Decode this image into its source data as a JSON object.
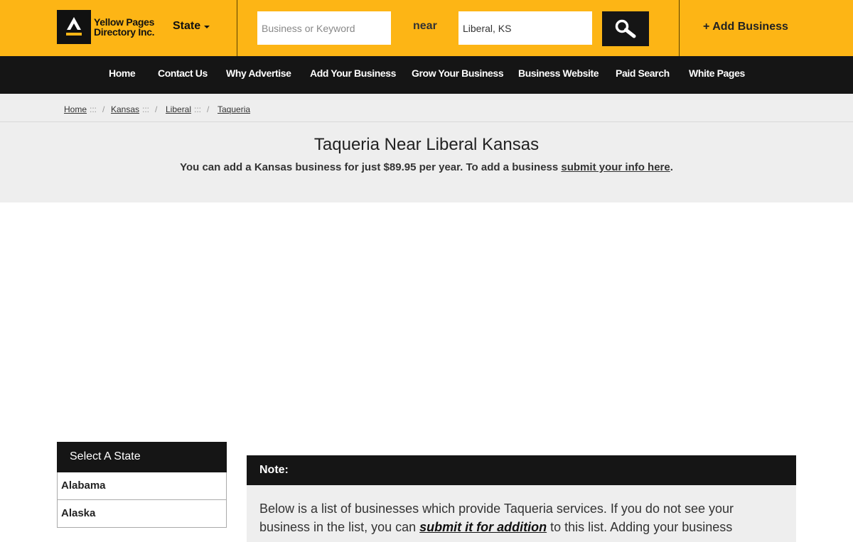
{
  "header": {
    "logo_line1": "Yellow Pages",
    "logo_line2": "Directory Inc.",
    "state_label": "State",
    "keyword_placeholder": "Business or Keyword",
    "near_label": "near",
    "location_value": "Liberal, KS",
    "search_icon": "magnifier-icon",
    "add_business": "+ Add Business",
    "colors": {
      "brand": "#fdb515",
      "dark": "#151515"
    }
  },
  "nav": {
    "items": [
      {
        "label": "Home"
      },
      {
        "label": "Contact Us"
      },
      {
        "label": "Why Advertise"
      },
      {
        "label": "Add Your Business"
      },
      {
        "label": "Grow Your Business"
      },
      {
        "label": "Business Website"
      },
      {
        "label": "Paid Search"
      },
      {
        "label": "White Pages"
      }
    ]
  },
  "breadcrumb": {
    "items": [
      "Home",
      "Kansas",
      "Liberal",
      "Taqueria"
    ],
    "sep": ":::",
    "slash": "/"
  },
  "main": {
    "title": "Taqueria Near Liberal Kansas",
    "subtitle_prefix": "You can add a Kansas business for just $89.95 per year. To add a business ",
    "subtitle_link": "submit your info here",
    "subtitle_suffix": "."
  },
  "sidebar": {
    "heading": "Select A State",
    "states": [
      "Alabama",
      "Alaska"
    ]
  },
  "note": {
    "heading": "Note:",
    "text_prefix": "Below is a list of businesses which provide Taqueria services. If you do not see your business in the list, you can ",
    "text_link": "submit it for addition",
    "text_suffix": " to this list. Adding your business"
  }
}
